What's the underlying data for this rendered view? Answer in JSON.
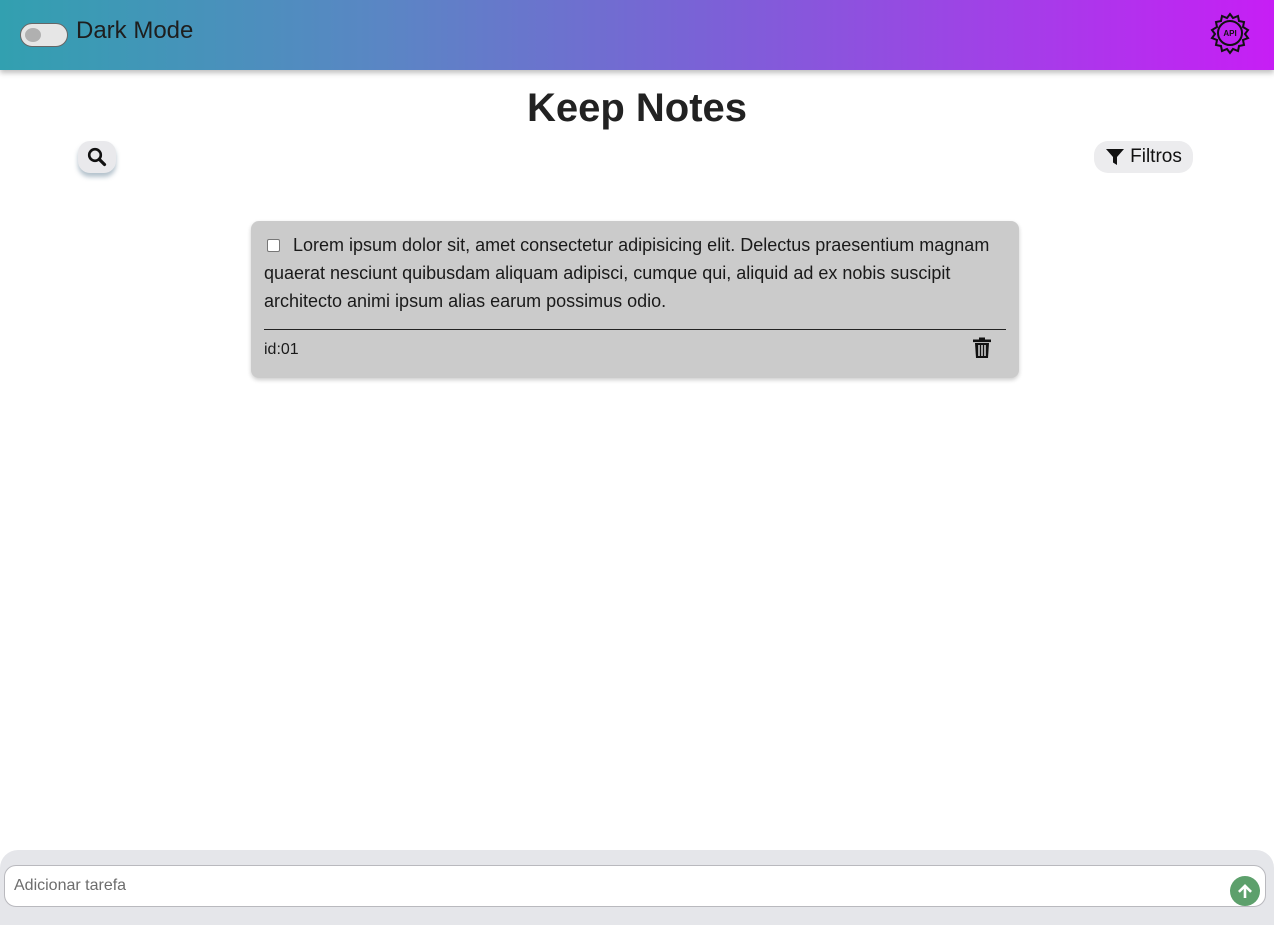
{
  "header": {
    "dark_mode_label": "Dark Mode",
    "dark_mode_on": false,
    "api_icon": "api-gear-icon"
  },
  "main": {
    "title": "Keep Notes",
    "search_icon": "search-icon",
    "filter_label": "Filtros",
    "filter_icon": "funnel-icon"
  },
  "notes": [
    {
      "text": "Lorem ipsum dolor sit, amet consectetur adipisicing elit. Delectus praesentium magnam quaerat nesciunt quibusdam aliquam adipisci, cumque qui, aliquid ad ex nobis suscipit architecto animi ipsum alias earum possimus odio.",
      "id_label": "id:01",
      "checked": false,
      "delete_icon": "trash-icon"
    }
  ],
  "composer": {
    "placeholder": "Adicionar tarefa",
    "value": "",
    "send_icon": "arrow-up-icon"
  },
  "colors": {
    "header_gradient_start": "#32a0b0",
    "header_gradient_end": "#c71ef5",
    "note_background": "#cbcbcb",
    "send_button": "#5da06c"
  }
}
